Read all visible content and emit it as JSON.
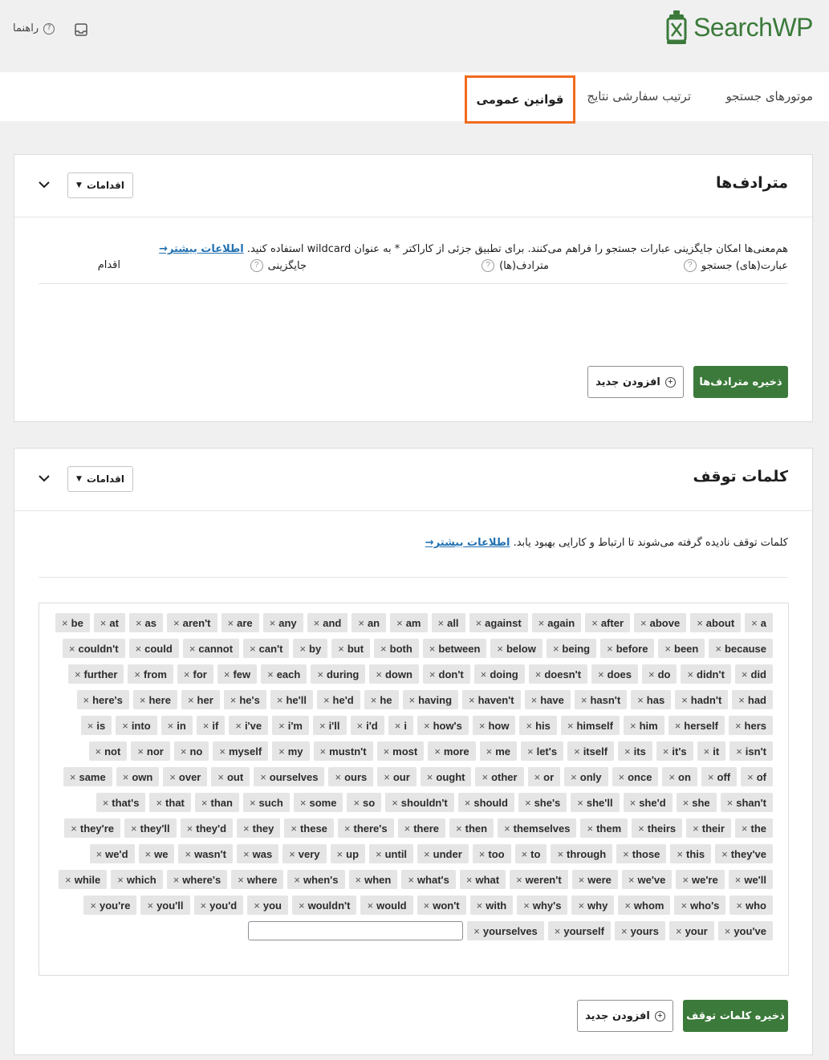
{
  "header": {
    "brand": "SearchWP",
    "help_label": "راهنما"
  },
  "tabs": [
    "موتورهای جستجو",
    "ترتیب سفارشی نتایج",
    "قوانین عمومی"
  ],
  "synonyms": {
    "title": "مترادف‌ها",
    "actions_label": "اقدامات",
    "description": "هم‌معنی‌ها امکان جایگزینی عبارات جستجو را فراهم می‌کنند. برای تطبیق جزئی از کاراکتر * به عنوان wildcard استفاده کنید.",
    "learn_more": "اطلاعات بیشتر→",
    "columns": {
      "search_terms": "عبارت(های) جستجو",
      "synonyms": "مترادف(ها)",
      "replace": "جایگزینی",
      "action": "اقدام"
    },
    "save_label": "ذخیره مترادف‌ها",
    "add_label": "افزودن جدید"
  },
  "stopwords": {
    "title": "کلمات توقف",
    "actions_label": "اقدامات",
    "description": "کلمات توقف نادیده گرفته می‌شوند تا ارتباط و کارایی بهبود یابد.",
    "learn_more": "اطلاعات بیشتر→",
    "save_label": "ذخیره کلمات توقف",
    "add_label": "افزودن جدید",
    "words": [
      "a",
      "about",
      "above",
      "after",
      "again",
      "against",
      "all",
      "am",
      "an",
      "and",
      "any",
      "are",
      "aren't",
      "as",
      "at",
      "be",
      "because",
      "been",
      "before",
      "being",
      "below",
      "between",
      "both",
      "but",
      "by",
      "can't",
      "cannot",
      "could",
      "couldn't",
      "did",
      "didn't",
      "do",
      "does",
      "doesn't",
      "doing",
      "don't",
      "down",
      "during",
      "each",
      "few",
      "for",
      "from",
      "further",
      "had",
      "hadn't",
      "has",
      "hasn't",
      "have",
      "haven't",
      "having",
      "he",
      "he'd",
      "he'll",
      "he's",
      "her",
      "here",
      "here's",
      "hers",
      "herself",
      "him",
      "himself",
      "his",
      "how",
      "how's",
      "i",
      "i'd",
      "i'll",
      "i'm",
      "i've",
      "if",
      "in",
      "into",
      "is",
      "isn't",
      "it",
      "it's",
      "its",
      "itself",
      "let's",
      "me",
      "more",
      "most",
      "mustn't",
      "my",
      "myself",
      "no",
      "nor",
      "not",
      "of",
      "off",
      "on",
      "once",
      "only",
      "or",
      "other",
      "ought",
      "our",
      "ours",
      "ourselves",
      "out",
      "over",
      "own",
      "same",
      "shan't",
      "she",
      "she'd",
      "she'll",
      "she's",
      "should",
      "shouldn't",
      "so",
      "some",
      "such",
      "than",
      "that",
      "that's",
      "the",
      "their",
      "theirs",
      "them",
      "themselves",
      "then",
      "there",
      "there's",
      "these",
      "they",
      "they'd",
      "they'll",
      "they're",
      "they've",
      "this",
      "those",
      "through",
      "to",
      "too",
      "under",
      "until",
      "up",
      "very",
      "was",
      "wasn't",
      "we",
      "we'd",
      "we'll",
      "we're",
      "we've",
      "were",
      "weren't",
      "what",
      "what's",
      "when",
      "when's",
      "where",
      "where's",
      "which",
      "while",
      "who",
      "who's",
      "whom",
      "why",
      "why's",
      "with",
      "won't",
      "would",
      "wouldn't",
      "you",
      "you'd",
      "you'll",
      "you're",
      "you've",
      "your",
      "yours",
      "yourself",
      "yourselves"
    ]
  }
}
